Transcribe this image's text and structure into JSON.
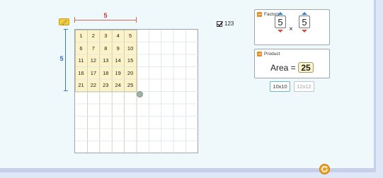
{
  "dimensions": {
    "width_label": "5",
    "height_label": "5"
  },
  "grid": {
    "rows": 10,
    "cols": 10,
    "filled_rows": 5,
    "filled_cols": 5,
    "cells": [
      [
        "1",
        "2",
        "3",
        "4",
        "5"
      ],
      [
        "6",
        "7",
        "8",
        "9",
        "10"
      ],
      [
        "11",
        "12",
        "13",
        "14",
        "15"
      ],
      [
        "16",
        "17",
        "18",
        "19",
        "20"
      ],
      [
        "21",
        "22",
        "23",
        "24",
        "25"
      ]
    ],
    "filled_color": "#fbf3c7"
  },
  "label_toggle": {
    "text": "123",
    "checked": true
  },
  "factors": {
    "title": "Factors",
    "factor_a": "5",
    "operator": "×",
    "factor_b": "5"
  },
  "product": {
    "title": "Product",
    "label": "Area =",
    "value": "25"
  },
  "size_buttons": {
    "small": "10x10",
    "large": "12x12",
    "active": "10x10"
  },
  "colors": {
    "width_accent": "#d2352c",
    "height_accent": "#2f6fc6",
    "button_orange": "#f08b26"
  },
  "icons": {
    "edit": "pencil-icon",
    "collapse": "minus-icon",
    "reset": "reset-icon",
    "resize": "resize-handle-icon"
  }
}
